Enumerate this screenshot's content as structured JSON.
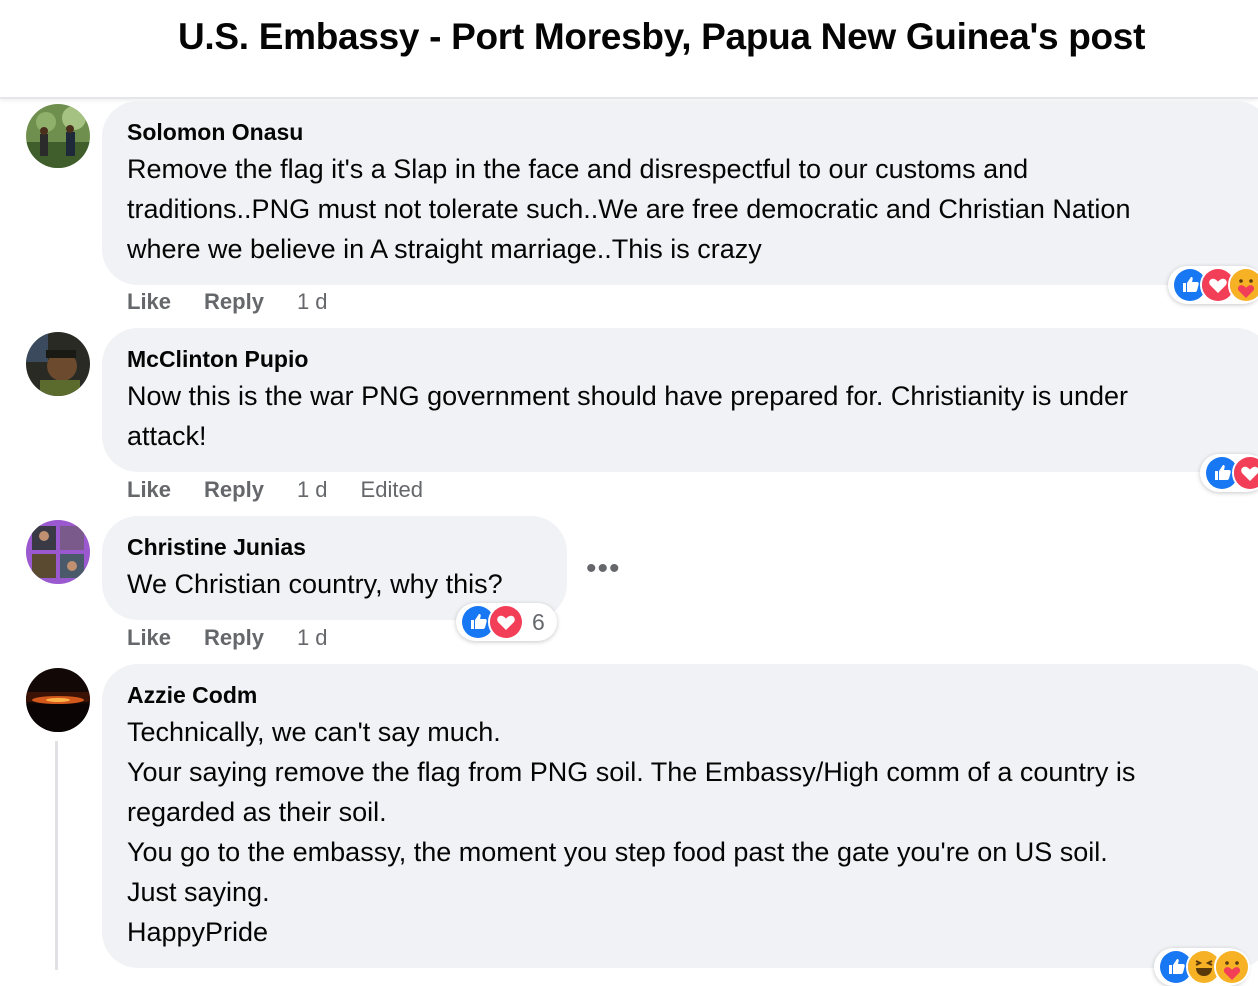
{
  "header": {
    "title": "U.S. Embassy - Port Moresby, Papua New Guinea's post"
  },
  "actions": {
    "like": "Like",
    "reply": "Reply"
  },
  "comments": [
    {
      "author": "Solomon Onasu",
      "lines": [
        "Remove the flag it's a Slap in the face and disrespectful to our customs and",
        "traditions..PNG must not tolerate such..We are free democratic and Christian Nation",
        "where we believe in A straight marriage..This is crazy"
      ],
      "time": "1 d",
      "reactions": [
        "like-reaction-icon",
        "love-reaction-icon",
        "care-reaction-icon"
      ]
    },
    {
      "author": "McClinton Pupio",
      "lines": [
        "Now this is the war PNG government should have prepared for. Christianity is under",
        "attack!"
      ],
      "time": "1 d",
      "edited": "Edited",
      "reactions": [
        "like-reaction-icon",
        "love-reaction-icon"
      ]
    },
    {
      "author": "Christine Junias",
      "lines": [
        "We Christian country, why this?"
      ],
      "time": "1 d",
      "reactions": [
        "like-reaction-icon",
        "love-reaction-icon"
      ],
      "reaction_count": "6",
      "more_options": "•••"
    },
    {
      "author": "Azzie Codm",
      "lines": [
        "Technically, we can't say much.",
        "Your saying remove the flag from PNG soil. The Embassy/High comm of a country is",
        "regarded as their soil.",
        "You go to the embassy, the moment you step food past the gate you're on US soil.",
        "Just saying.",
        "HappyPride"
      ],
      "reactions": [
        "like-reaction-icon",
        "haha-reaction-icon",
        "care-reaction-icon"
      ]
    }
  ],
  "colors": {
    "like": "#1877f2",
    "love": "#f33e58",
    "care": "#f7b125",
    "secondary_text": "#65676b",
    "bubble": "#f0f2f5"
  }
}
